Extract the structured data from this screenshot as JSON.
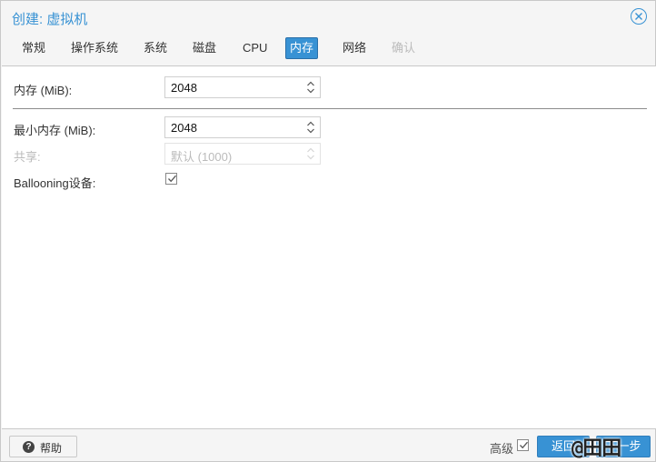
{
  "window": {
    "title": "创建: 虚拟机"
  },
  "tabs": [
    {
      "label": "常规",
      "state": "normal"
    },
    {
      "label": "操作系统",
      "state": "normal"
    },
    {
      "label": "系统",
      "state": "normal"
    },
    {
      "label": "磁盘",
      "state": "normal"
    },
    {
      "label": "CPU",
      "state": "normal"
    },
    {
      "label": "内存",
      "state": "active"
    },
    {
      "label": "网络",
      "state": "normal"
    },
    {
      "label": "确认",
      "state": "disabled"
    }
  ],
  "form": {
    "memory": {
      "label": "内存 (MiB):",
      "value": "2048"
    },
    "min_memory": {
      "label": "最小内存 (MiB):",
      "value": "2048"
    },
    "shares": {
      "label": "共享:",
      "placeholder": "默认 (1000)",
      "disabled": true
    },
    "ballooning": {
      "label": "Ballooning设备:",
      "checked": true
    }
  },
  "footer": {
    "help_label": "帮助",
    "advanced_label": "高级",
    "advanced_checked": true,
    "back_label": "返回",
    "next_label": "下一步"
  },
  "watermark": "@田田",
  "colors": {
    "accent": "#3892d4",
    "disabled_text": "#bbbbbb"
  },
  "icons": {
    "close": "close-circle-icon",
    "help": "question-circle-icon",
    "spinner": "up-down-chevron-icon",
    "check": "checkmark-icon"
  }
}
